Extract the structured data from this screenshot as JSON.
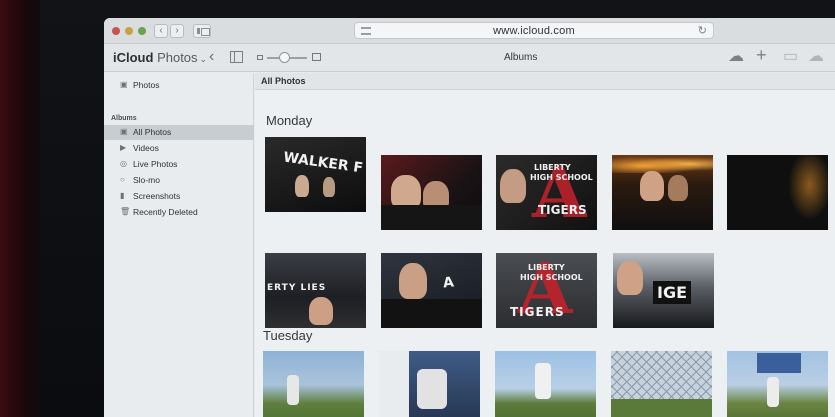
{
  "browser": {
    "url": "www.icloud.com"
  },
  "app": {
    "brand": "iCloud",
    "section": "Photos",
    "view_title": "Albums"
  },
  "sidebar": {
    "top_item": "Photos",
    "albums_header": "Albums",
    "items": [
      {
        "label": "All Photos",
        "icon": "photo-stack-icon",
        "selected": true
      },
      {
        "label": "Videos",
        "icon": "video-icon",
        "selected": false
      },
      {
        "label": "Live Photos",
        "icon": "live-photo-icon",
        "selected": false
      },
      {
        "label": "Slo-mo",
        "icon": "slomo-icon",
        "selected": false
      },
      {
        "label": "Screenshots",
        "icon": "phone-icon",
        "selected": false
      },
      {
        "label": "Recently Deleted",
        "icon": "trash-icon",
        "selected": false
      }
    ]
  },
  "content": {
    "header": "All Photos",
    "sections": [
      {
        "day": "Monday"
      },
      {
        "day": "Tuesday"
      }
    ],
    "photo_text": {
      "walker": "WALKER F",
      "liberty_line1": "LIBERTY",
      "liberty_line2": "HIGH SCHOOL",
      "tigers": "TIGERS",
      "liberty_banner": "ERTY LIES"
    }
  },
  "colors": {
    "screen_bg": "#e7ebee",
    "sidebar_selected": "#c8cdd2",
    "school_red": "#c3222b"
  }
}
